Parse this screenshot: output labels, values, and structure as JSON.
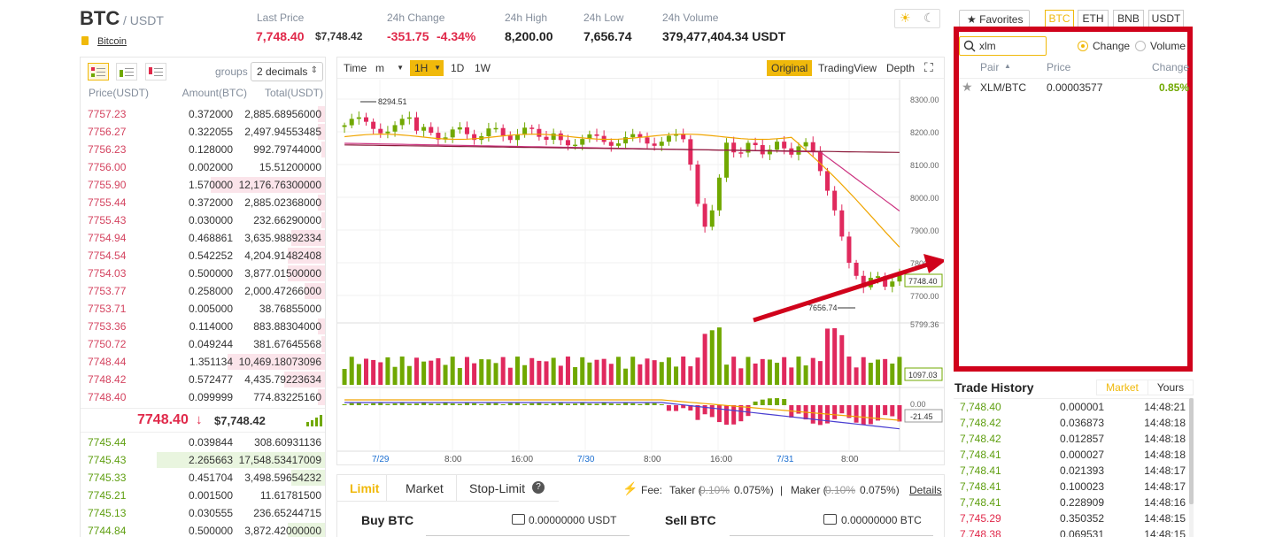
{
  "header": {
    "base": "BTC",
    "quote": "/ USDT",
    "coin_name": "Bitcoin",
    "stats": [
      {
        "label": "Last Price",
        "value": "7,748.40",
        "extra": "$7,748.42"
      },
      {
        "label": "24h Change",
        "value": "-351.75",
        "extra": "-4.34%"
      },
      {
        "label": "24h High",
        "value": "8,200.00"
      },
      {
        "label": "24h Low",
        "value": "7,656.74"
      },
      {
        "label": "24h Volume",
        "value": "379,477,404.34 USDT"
      }
    ]
  },
  "orderbook": {
    "groups_label": "groups",
    "groups_value": "2 decimals",
    "headers": [
      "Price(USDT)",
      "Amount(BTC)",
      "Total(USDT)"
    ],
    "asks": [
      {
        "price": "7757.23",
        "amount": "0.372000",
        "total": "2,885.68956000",
        "depth": 0.04
      },
      {
        "price": "7756.27",
        "amount": "0.322055",
        "total": "2,497.94553485",
        "depth": 0.04
      },
      {
        "price": "7756.23",
        "amount": "0.128000",
        "total": "992.79744000",
        "depth": 0.02
      },
      {
        "price": "7756.00",
        "amount": "0.002000",
        "total": "15.51200000",
        "depth": 0.0
      },
      {
        "price": "7755.90",
        "amount": "1.570000",
        "total": "12,176.76300000",
        "depth": 0.68
      },
      {
        "price": "7755.44",
        "amount": "0.372000",
        "total": "2,885.02368000",
        "depth": 0.04
      },
      {
        "price": "7755.43",
        "amount": "0.030000",
        "total": "232.66290000",
        "depth": 0.02
      },
      {
        "price": "7754.94",
        "amount": "0.468861",
        "total": "3,635.98892334",
        "depth": 0.2
      },
      {
        "price": "7754.54",
        "amount": "0.542252",
        "total": "4,204.91482408",
        "depth": 0.22
      },
      {
        "price": "7754.03",
        "amount": "0.500000",
        "total": "3,877.01500000",
        "depth": 0.22
      },
      {
        "price": "7753.77",
        "amount": "0.258000",
        "total": "2,000.47266000",
        "depth": 0.12
      },
      {
        "price": "7753.71",
        "amount": "0.005000",
        "total": "38.76855000",
        "depth": 0.0
      },
      {
        "price": "7753.36",
        "amount": "0.114000",
        "total": "883.88304000",
        "depth": 0.04
      },
      {
        "price": "7750.72",
        "amount": "0.049244",
        "total": "381.67645568",
        "depth": 0.02
      },
      {
        "price": "7748.44",
        "amount": "1.351134",
        "total": "10,469.18073096",
        "depth": 0.58
      },
      {
        "price": "7748.42",
        "amount": "0.572477",
        "total": "4,435.79223634",
        "depth": 0.24
      },
      {
        "price": "7748.40",
        "amount": "0.099999",
        "total": "774.83225160",
        "depth": 0.04
      }
    ],
    "last_price": "7748.40",
    "last_arrow": "↓",
    "last_usd": "$7,748.42",
    "bids": [
      {
        "price": "7745.44",
        "amount": "0.039844",
        "total": "308.60931136",
        "depth": 0.0
      },
      {
        "price": "7745.43",
        "amount": "2.265663",
        "total": "17,548.53417009",
        "depth": 1.0
      },
      {
        "price": "7745.33",
        "amount": "0.451704",
        "total": "3,498.59654232",
        "depth": 0.2
      },
      {
        "price": "7745.21",
        "amount": "0.001500",
        "total": "11.61781500",
        "depth": 0.0
      },
      {
        "price": "7745.13",
        "amount": "0.030555",
        "total": "236.65244715",
        "depth": 0.0
      },
      {
        "price": "7744.84",
        "amount": "0.500000",
        "total": "3,872.42000000",
        "depth": 0.22
      }
    ]
  },
  "chart": {
    "toolbar": [
      "Time",
      "m",
      "1H",
      "1D",
      "1W"
    ],
    "views": [
      "Original",
      "TradingView",
      "Depth"
    ],
    "high_label": "8294.51",
    "low_label": "7656.74",
    "current_label": "7748.40",
    "price_ticks": [
      "8300.00",
      "8200.00",
      "8100.00",
      "8000.00",
      "7900.00",
      "7800.00",
      "7700.00"
    ],
    "volume_top": "5799.36",
    "volume_label": "1097.03",
    "macd_top": "0.00",
    "macd_label": "-21.45",
    "time_ticks": [
      "7/29",
      "8:00",
      "16:00",
      "7/30",
      "8:00",
      "16:00",
      "7/31",
      "8:00"
    ]
  },
  "form": {
    "tabs": [
      "Limit",
      "Market",
      "Stop-Limit"
    ],
    "fee_label": "Fee:",
    "taker_label": "Taker (",
    "taker_old": "0.10%",
    "taker_new": "0.075%)",
    "maker_label": "Maker (",
    "maker_old": "0.10%",
    "maker_new": "0.075%)",
    "details": "Details",
    "buy_title": "Buy BTC",
    "buy_balance": "0.00000000 USDT",
    "sell_title": "Sell BTC",
    "sell_balance": "0.00000000 BTC"
  },
  "markets": {
    "favorites": "Favorites",
    "tabs": [
      "BTC",
      "ETH",
      "BNB",
      "USDT"
    ],
    "search_value": "xlm",
    "radio_change": "Change",
    "radio_volume": "Volume",
    "headers": [
      "Pair",
      "Price",
      "Change"
    ],
    "rows": [
      {
        "pair": "XLM/BTC",
        "price": "0.00003577",
        "change": "0.85%"
      }
    ]
  },
  "history": {
    "title": "Trade History",
    "tabs": [
      "Market",
      "Yours"
    ],
    "rows": [
      {
        "price": "7,748.40",
        "amount": "0.000001",
        "time": "14:48:21",
        "side": "buy"
      },
      {
        "price": "7,748.42",
        "amount": "0.036873",
        "time": "14:48:18",
        "side": "buy"
      },
      {
        "price": "7,748.42",
        "amount": "0.012857",
        "time": "14:48:18",
        "side": "buy"
      },
      {
        "price": "7,748.41",
        "amount": "0.000027",
        "time": "14:48:18",
        "side": "buy"
      },
      {
        "price": "7,748.41",
        "amount": "0.021393",
        "time": "14:48:17",
        "side": "buy"
      },
      {
        "price": "7,748.41",
        "amount": "0.100023",
        "time": "14:48:17",
        "side": "buy"
      },
      {
        "price": "7,748.41",
        "amount": "0.228909",
        "time": "14:48:16",
        "side": "buy"
      },
      {
        "price": "7,745.29",
        "amount": "0.350352",
        "time": "14:48:15",
        "side": "sell"
      },
      {
        "price": "7,748.38",
        "amount": "0.069531",
        "time": "14:48:15",
        "side": "sell"
      }
    ]
  },
  "colors": {
    "accent": "#f0b90b",
    "up": "#70a800",
    "down": "#e0294a",
    "highlight_box": "#d0021b",
    "arrow": "#d0021b"
  }
}
